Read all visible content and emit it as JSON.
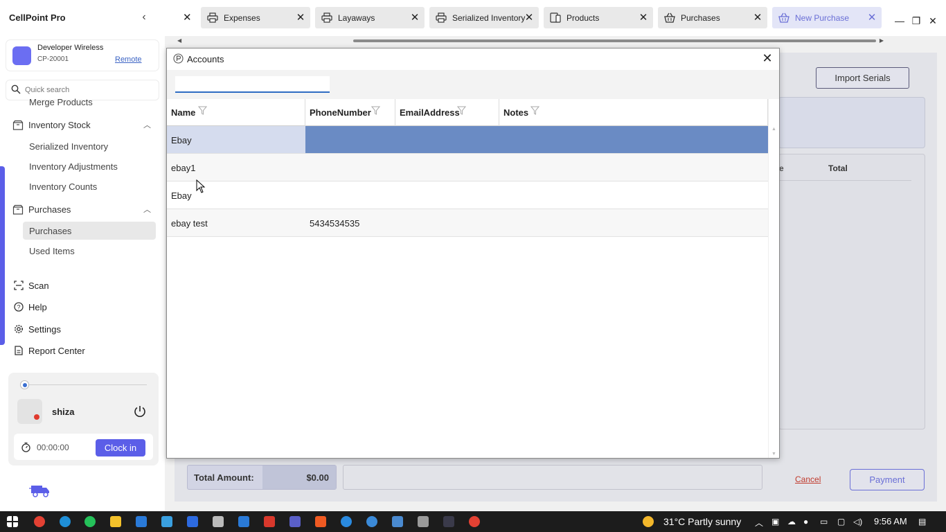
{
  "app": {
    "title": "CellPoint Pro"
  },
  "store": {
    "name": "Developer Wireless",
    "id": "CP-20001",
    "remote_label": "Remote"
  },
  "search": {
    "placeholder": "Quick search"
  },
  "sidebar": {
    "merge_products": "Merge Products",
    "inventory_stock": "Inventory Stock",
    "serialized_inventory": "Serialized Inventory",
    "inventory_adjustments": "Inventory Adjustments",
    "inventory_counts": "Inventory Counts",
    "purchases_group": "Purchases",
    "purchases": "Purchases",
    "used_items": "Used Items",
    "scan": "Scan",
    "help": "Help",
    "settings": "Settings",
    "report_center": "Report Center"
  },
  "user": {
    "name": "shiza",
    "timer": "00:00:00",
    "clockin_label": "Clock in"
  },
  "tabs": [
    {
      "label": "Expenses",
      "icon": "printer-icon"
    },
    {
      "label": "Layaways",
      "icon": "printer-icon"
    },
    {
      "label": "Serialized Inventory",
      "icon": "printer-icon"
    },
    {
      "label": "Products",
      "icon": "device-icon"
    },
    {
      "label": "Purchases",
      "icon": "basket-icon"
    },
    {
      "label": "New Purchase",
      "icon": "basket-icon"
    }
  ],
  "background": {
    "import_serials": "Import Serials",
    "col_e": "e",
    "col_total": "Total",
    "total_amount_label": "Total Amount:",
    "total_amount_value": "$0.00",
    "cancel_label": "Cancel",
    "payment_label": "Payment"
  },
  "dialog": {
    "title": "Accounts",
    "search_value": "",
    "columns": [
      "Name",
      "PhoneNumber",
      "EmailAddress",
      "Notes"
    ],
    "rows": [
      {
        "name": "Ebay",
        "phone": "",
        "email": "",
        "notes": ""
      },
      {
        "name": "ebay1",
        "phone": "",
        "email": "",
        "notes": ""
      },
      {
        "name": "Ebay",
        "phone": "",
        "email": "",
        "notes": ""
      },
      {
        "name": "ebay test",
        "phone": "5434534535",
        "email": "",
        "notes": ""
      }
    ],
    "selected_row": 0
  },
  "taskbar": {
    "weather": "31°C  Partly sunny",
    "time": "9:56 AM"
  },
  "colors": {
    "accent": "#5b5ee8",
    "selected_row": "#6a8bc4",
    "tab_active_text": "#6a6fd6",
    "cancel": "#c0392b"
  }
}
